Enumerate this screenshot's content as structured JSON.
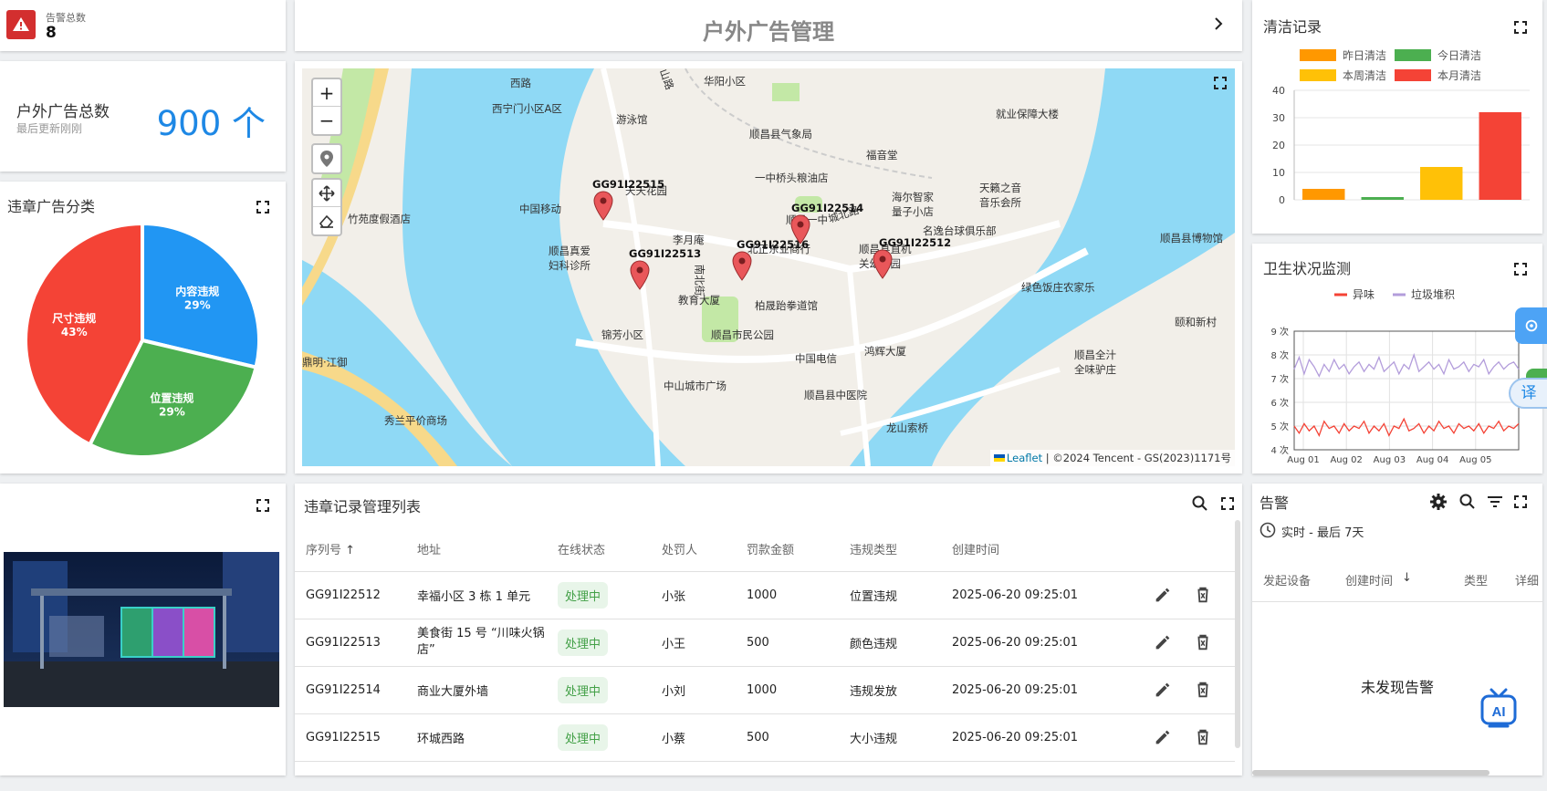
{
  "alert_total": {
    "label": "告警总数",
    "value": "8",
    "color": "#d32f2f"
  },
  "ad_total": {
    "label": "户外广告总数",
    "sub": "最后更新刚刚",
    "value": "900 个",
    "color": "#1e88e5"
  },
  "page": {
    "title": "户外广告管理"
  },
  "pie": {
    "title": "违章广告分类",
    "chart_data": {
      "type": "pie",
      "slices": [
        {
          "name": "内容违规",
          "value": 29,
          "label": "29%",
          "color": "#2196f3"
        },
        {
          "name": "位置违规",
          "value": 29,
          "label": "29%",
          "color": "#4caf50"
        },
        {
          "name": "尺寸违规",
          "value": 43,
          "label": "43%",
          "color": "#f44336"
        }
      ]
    }
  },
  "map": {
    "attribution_link": "Leaflet",
    "attribution": "| ©2024 Tencent - GS(2023)1171号",
    "zoom_in": "+",
    "zoom_out": "−",
    "markers": [
      {
        "id": "GG91I22515"
      },
      {
        "id": "GG91I22513"
      },
      {
        "id": "GG91I22516"
      },
      {
        "id": "GG91I22514"
      },
      {
        "id": "GG91I22512"
      }
    ],
    "places": [
      "华阳小区",
      "西宁门小区A区",
      "游泳馆",
      "顺昌县气象局",
      "福音堂",
      "就业保障大楼",
      "一中桥头粮油店",
      "天天花园",
      "中国移动",
      "竹苑度假酒店",
      "海尔智家量子小店",
      "天籁之音音乐会所",
      "顺昌一中",
      "城北路",
      "名逸台球俱乐部",
      "顺昌县博物馆",
      "李月庵",
      "北正东业商行",
      "顺昌县直机关幼儿园",
      "顺昌真爱妇科诊所",
      "教育大厦",
      "柏晟跆拳道馆",
      "绿色饭庄农家乐",
      "锦芳小区",
      "顺昌市民公园",
      "中国电信",
      "鸿辉大厦",
      "颐和新村",
      "中山城市广场",
      "顺昌县中医院",
      "顺昌全汁全味驴庄",
      "秀兰平价商场",
      "龙山索桥",
      "西路",
      "山路",
      "南北街",
      "鼎明·江御"
    ]
  },
  "clean": {
    "title": "清洁记录",
    "chart_data": {
      "type": "bar",
      "series": [
        {
          "name": "昨日清洁",
          "values": [
            4
          ],
          "color": "#ff9800"
        },
        {
          "name": "今日清洁",
          "values": [
            1
          ],
          "color": "#4caf50"
        },
        {
          "name": "本周清洁",
          "values": [
            12
          ],
          "color": "#ffc107"
        },
        {
          "name": "本月清洁",
          "values": [
            32
          ],
          "color": "#f44336"
        }
      ],
      "ylim": [
        0,
        40
      ],
      "yticks": [
        "0",
        "10",
        "20",
        "30",
        "40"
      ]
    }
  },
  "hygiene": {
    "title": "卫生状况监测",
    "chart_data": {
      "type": "line",
      "series": [
        {
          "name": "异味",
          "color": "#f44336",
          "values": [
            5.0,
            4.7,
            5.1,
            4.8,
            5.0,
            4.6,
            5.2,
            4.9,
            5.0,
            4.7,
            5.1,
            4.8,
            5.0,
            4.9,
            5.2,
            4.7,
            5.0,
            4.8,
            5.1,
            4.6,
            5.0,
            4.9,
            5.3,
            4.8,
            4.9,
            5.1,
            4.7,
            5.0,
            4.8,
            5.2,
            4.9,
            5.0,
            4.7,
            5.1,
            4.9,
            5.0,
            4.8,
            5.1,
            4.7,
            5.0,
            4.9,
            5.2,
            4.8,
            5.0,
            4.9,
            5.1
          ]
        },
        {
          "name": "垃圾堆积",
          "color": "#b39ddb",
          "values": [
            7.4,
            7.9,
            7.2,
            7.8,
            7.5,
            7.1,
            7.6,
            7.3,
            7.8,
            7.4,
            7.6,
            7.2,
            7.5,
            7.7,
            7.3,
            7.6,
            7.4,
            7.9,
            7.3,
            7.5,
            7.7,
            7.2,
            7.6,
            7.4,
            8.0,
            7.3,
            7.5,
            7.7,
            7.4,
            7.6,
            7.2,
            7.8,
            7.4,
            7.5,
            7.7,
            7.3,
            7.6,
            7.5,
            7.8,
            7.2,
            7.5,
            7.7,
            7.4,
            7.6,
            7.7,
            7.4
          ]
        }
      ],
      "ylim": [
        4,
        9
      ],
      "yticks": [
        "4 次",
        "5 次",
        "6 次",
        "7 次",
        "8 次",
        "9 次"
      ],
      "xticks": [
        "Aug 01",
        "Aug 02",
        "Aug 03",
        "Aug 04",
        "Aug 05"
      ]
    }
  },
  "table": {
    "title": "违章记录管理列表",
    "columns": [
      "序列号",
      "地址",
      "在线状态",
      "处罚人",
      "罚款金额",
      "违规类型",
      "创建时间"
    ],
    "rows": [
      [
        "GG91I22512",
        "幸福小区 3 栋 1 单元",
        "处理中",
        "小张",
        "1000",
        "位置违规",
        "2025-06-20 09:25:01"
      ],
      [
        "GG91I22513",
        "美食街 15 号 “川味火锅店”",
        "处理中",
        "小王",
        "500",
        "颜色违规",
        "2025-06-20 09:25:01"
      ],
      [
        "GG91I22514",
        "商业大厦外墙",
        "处理中",
        "小刘",
        "1000",
        "违规发放",
        "2025-06-20 09:25:01"
      ],
      [
        "GG91I22515",
        "环城西路",
        "处理中",
        "小蔡",
        "500",
        "大小违规",
        "2025-06-20 09:25:01"
      ]
    ]
  },
  "alarms": {
    "title": "告警",
    "range": "实时 - 最后 7天",
    "columns": [
      "发起设备",
      "创建时间",
      "类型",
      "详细"
    ],
    "empty": "未发现告警"
  },
  "side": {
    "translate": "译"
  }
}
